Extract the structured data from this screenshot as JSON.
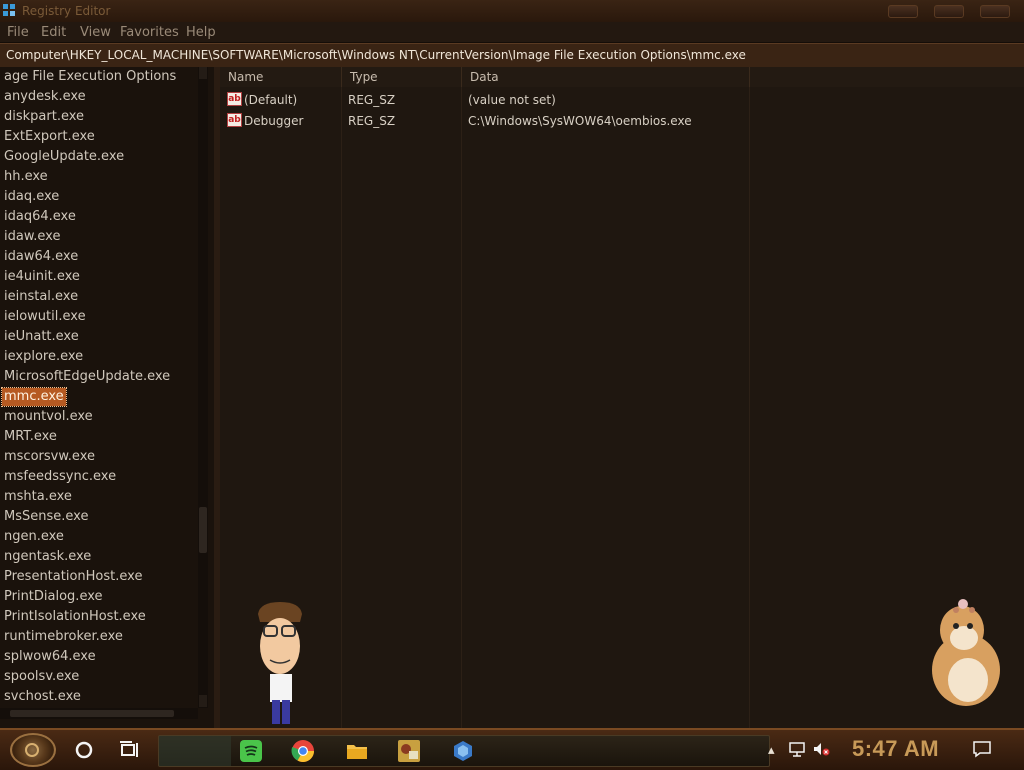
{
  "window": {
    "title": "Registry Editor",
    "controls": [
      "minimize-button",
      "maximize-button",
      "close-button"
    ]
  },
  "menu": [
    "File",
    "Edit",
    "View",
    "Favorites",
    "Help"
  ],
  "address": "Computer\\HKEY_LOCAL_MACHINE\\SOFTWARE\\Microsoft\\Windows NT\\CurrentVersion\\Image File Execution Options\\mmc.exe",
  "tree": {
    "items": [
      "age File Execution Options",
      "anydesk.exe",
      "diskpart.exe",
      "ExtExport.exe",
      "GoogleUpdate.exe",
      "hh.exe",
      "idaq.exe",
      "idaq64.exe",
      "idaw.exe",
      "idaw64.exe",
      "ie4uinit.exe",
      "ieinstal.exe",
      "ielowutil.exe",
      "ieUnatt.exe",
      "iexplore.exe",
      "MicrosoftEdgeUpdate.exe",
      "mmc.exe",
      "mountvol.exe",
      "MRT.exe",
      "mscorsvw.exe",
      "msfeedssync.exe",
      "mshta.exe",
      "MsSense.exe",
      "ngen.exe",
      "ngentask.exe",
      "PresentationHost.exe",
      "PrintDialog.exe",
      "PrintIsolationHost.exe",
      "runtimebroker.exe",
      "splwow64.exe",
      "spoolsv.exe",
      "svchost.exe"
    ],
    "selected": "mmc.exe"
  },
  "list": {
    "columns": [
      "Name",
      "Type",
      "Data"
    ],
    "rows": [
      {
        "icon": "string-value-icon",
        "icon_text": "ab",
        "name": "(Default)",
        "type": "REG_SZ",
        "data": "(value not set)"
      },
      {
        "icon": "string-value-icon",
        "icon_text": "ab",
        "name": "Debugger",
        "type": "REG_SZ",
        "data": "C:\\Windows\\SysWOW64\\oembios.exe"
      }
    ]
  },
  "taskbar": {
    "start": "start-orb-icon",
    "icons": [
      "cortana-circle-icon",
      "task-view-icon",
      "spotify-icon",
      "chrome-icon",
      "file-explorer-icon",
      "game-app-icon",
      "app-blue-icon"
    ],
    "tray_icons": [
      "network-icon",
      "volume-muted-icon",
      "notifications-icon"
    ],
    "clock": "5:47 AM"
  },
  "desktop": {
    "mascots": [
      "cartoon-man-mascot",
      "hamster-mascot"
    ]
  },
  "colors": {
    "selection": "#b65a22",
    "clock": "#c89a58",
    "background": "#1e1610"
  }
}
